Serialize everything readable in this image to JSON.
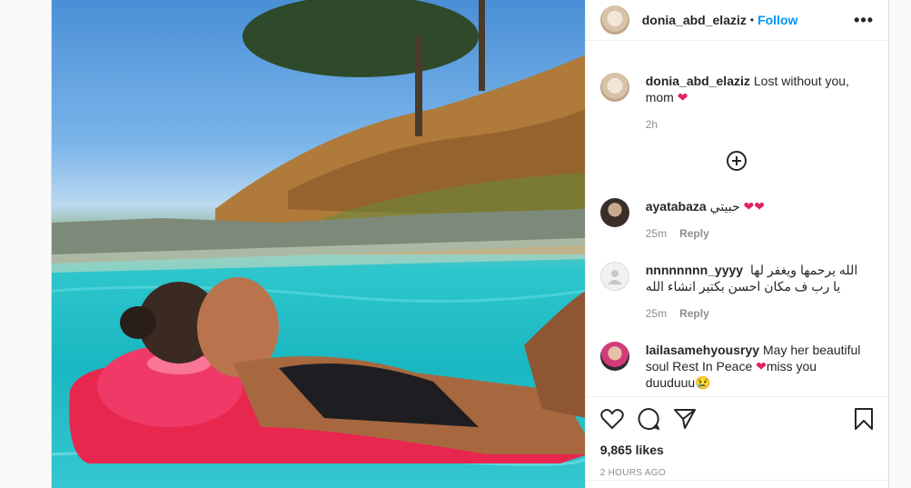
{
  "post": {
    "author": "donia_abd_elaziz",
    "dot": "•",
    "follow_label": "Follow",
    "more_label": "•••",
    "caption_author": "donia_abd_elaziz",
    "caption_text": "Lost without you, mom",
    "caption_time": "2h",
    "likes": "9,865 likes",
    "posted": "2 HOURS AGO"
  },
  "comments": [
    {
      "user": "ayatabaza",
      "text": "حبيتي",
      "hearts": "❤❤",
      "time": "25m",
      "reply": "Reply"
    },
    {
      "user": "nnnnnnnn_yyyy",
      "text": "الله يرحمها ويغفر لها يا رب ف مكان احسن بكتير انشاء الله",
      "time": "25m",
      "reply": "Reply"
    },
    {
      "user": "lailasamehyousryy",
      "text": "May her beautiful soul Rest In Peace",
      "after_heart": "miss you duuduuu",
      "emoji": "😢"
    }
  ],
  "icons": [
    "heart-outline-icon",
    "comment-icon",
    "share-icon",
    "bookmark-icon",
    "plus-circle-icon",
    "more-icon"
  ],
  "colors": {
    "follow": "#0095f6",
    "heart": "#e0245e",
    "muted": "#8e8e8e"
  }
}
